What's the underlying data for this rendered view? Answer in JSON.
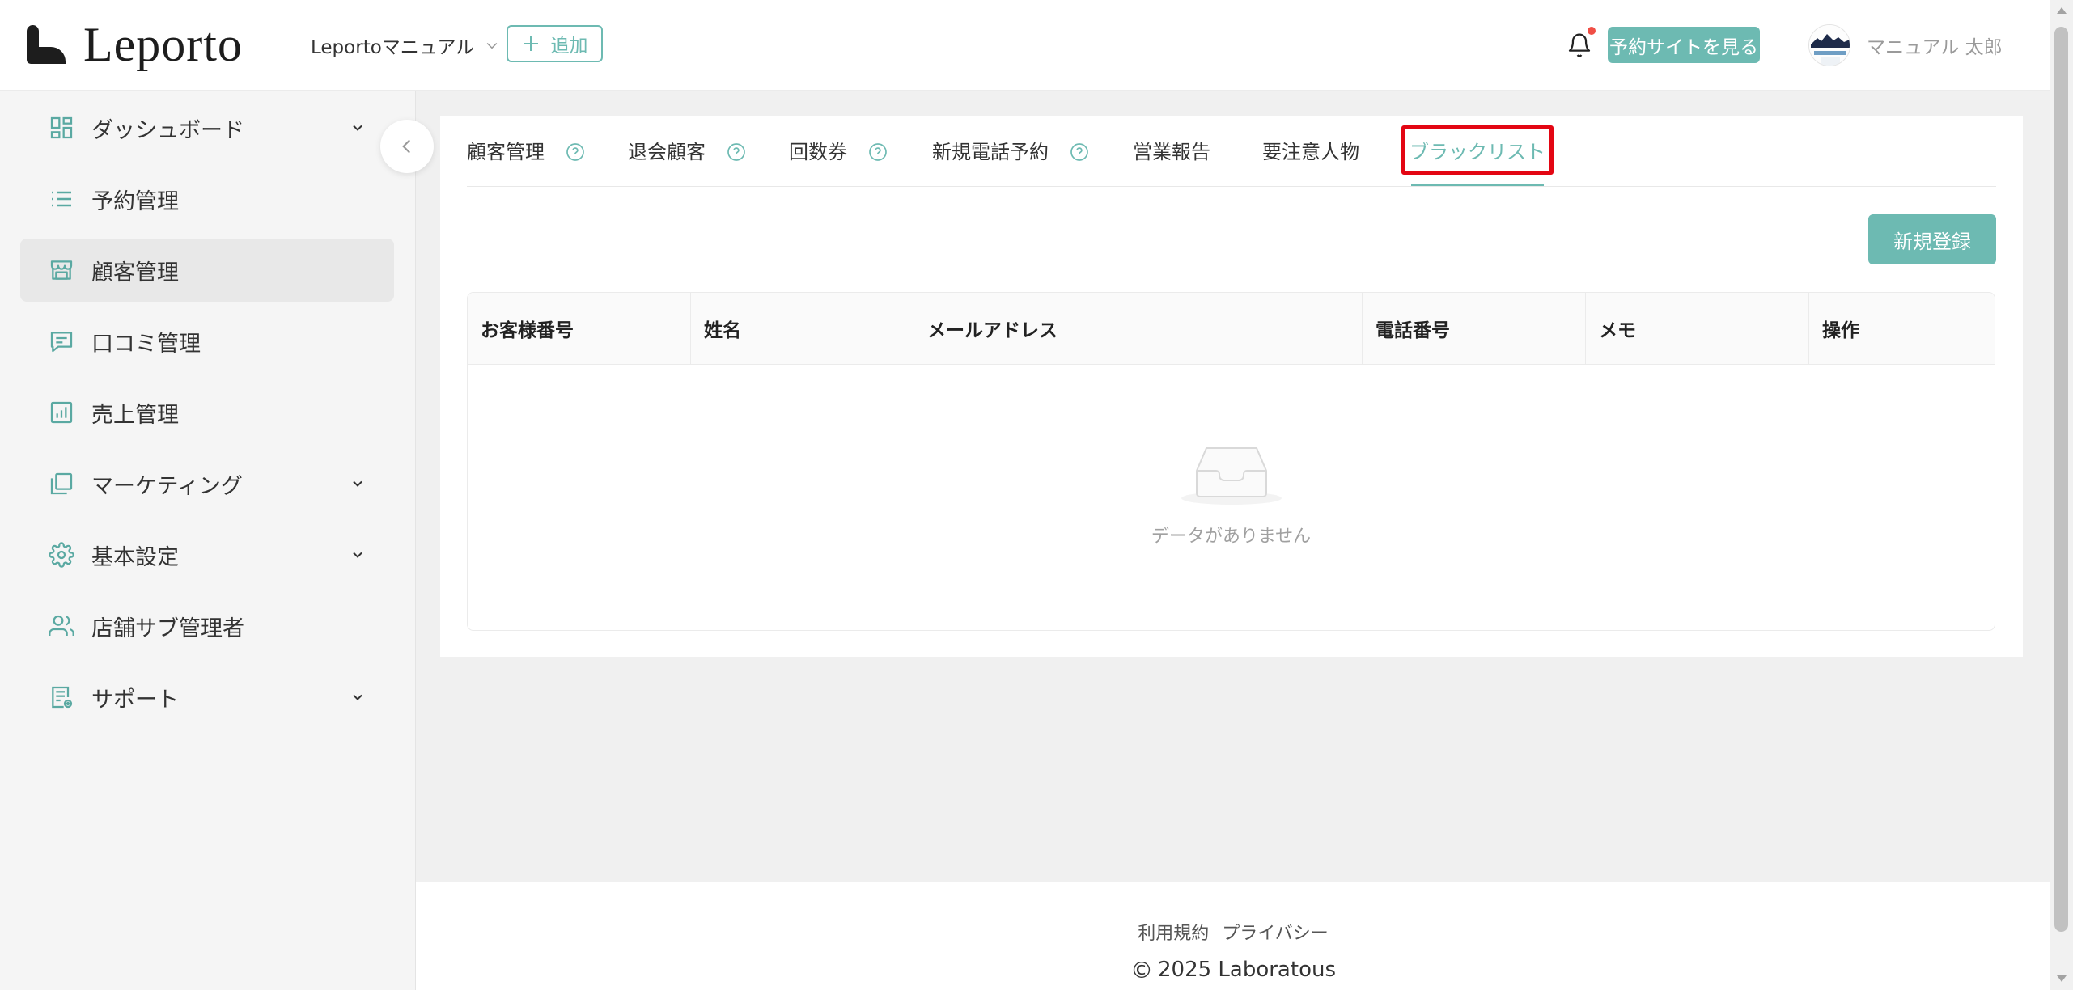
{
  "header": {
    "logo_text": "Leporto",
    "logo_icon": "leporto-logo-mark",
    "shop_selector": "Leportoマニュアル",
    "add_button": "追加",
    "view_site_button": "予約サイトを見る",
    "user_name": "マニュアル 太郎",
    "has_notification": true
  },
  "sidebar": {
    "items": [
      {
        "label": "ダッシュボード",
        "icon": "dashboard-icon",
        "expandable": true
      },
      {
        "label": "予約管理",
        "icon": "list-icon",
        "expandable": false
      },
      {
        "label": "顧客管理",
        "icon": "store-icon",
        "expandable": false,
        "selected": true
      },
      {
        "label": "口コミ管理",
        "icon": "comment-icon",
        "expandable": false
      },
      {
        "label": "売上管理",
        "icon": "chart-icon",
        "expandable": false
      },
      {
        "label": "マーケティング",
        "icon": "windows-icon",
        "expandable": true
      },
      {
        "label": "基本設定",
        "icon": "gear-icon",
        "expandable": true
      },
      {
        "label": "店舗サブ管理者",
        "icon": "users-icon",
        "expandable": false
      },
      {
        "label": "サポート",
        "icon": "support-doc-icon",
        "expandable": true
      }
    ]
  },
  "tabs": [
    {
      "label": "顧客管理",
      "help": true
    },
    {
      "label": "退会顧客",
      "help": true
    },
    {
      "label": "回数券",
      "help": true
    },
    {
      "label": "新規電話予約",
      "help": true
    },
    {
      "label": "営業報告",
      "help": false
    },
    {
      "label": "要注意人物",
      "help": false
    },
    {
      "label": "ブラックリスト",
      "help": false,
      "active": true,
      "highlighted": true
    }
  ],
  "toolbar": {
    "new_button": "新規登録"
  },
  "table": {
    "columns": [
      "お客様番号",
      "姓名",
      "メールアドレス",
      "電話番号",
      "メモ",
      "操作"
    ],
    "rows": [],
    "empty_text": "データがありません"
  },
  "footer": {
    "links": [
      "利用規約",
      "プライバシー"
    ],
    "copyright_symbol": "©",
    "copyright": "2025 Laboratous"
  },
  "colors": {
    "accent": "#6dbab2",
    "highlight_box": "#e30613",
    "notification_dot": "#f04e45"
  }
}
